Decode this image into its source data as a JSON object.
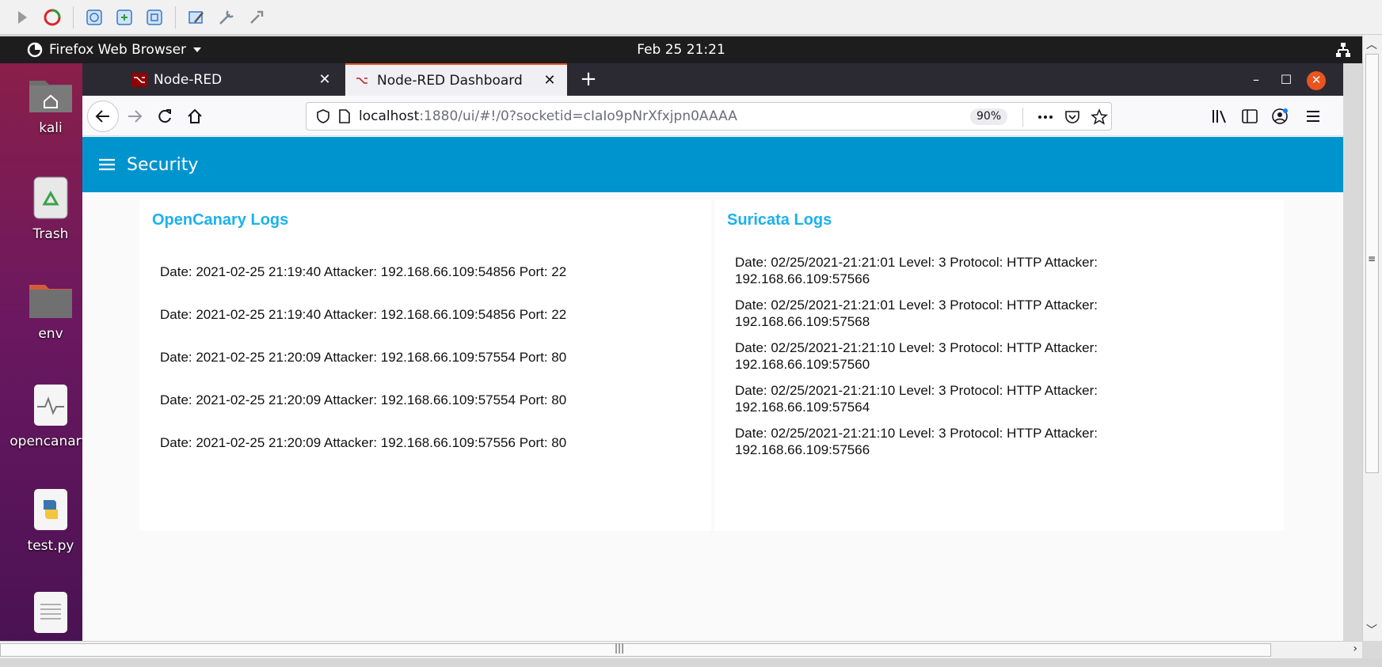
{
  "topbar": {
    "app_name": "Firefox Web Browser",
    "clock": "Feb 25  21:21"
  },
  "desktop": {
    "icons": [
      {
        "label": "kali"
      },
      {
        "label": "Trash"
      },
      {
        "label": "env"
      },
      {
        "label": "opencanary."
      },
      {
        "label": "test.py"
      }
    ]
  },
  "browser": {
    "tabs": [
      {
        "title": "Node-RED"
      },
      {
        "title": "Node-RED Dashboard"
      }
    ],
    "url_host": "localhost",
    "url_rest": ":1880/ui/#!/0?socketid=cIaIo9pNrXfxjpn0AAAA",
    "zoom": "90%"
  },
  "dashboard": {
    "title": "Security",
    "opencanary": {
      "title": "OpenCanary Logs",
      "entries": [
        "Date: 2021-02-25 21:19:40 Attacker: 192.168.66.109:54856 Port: 22",
        "Date: 2021-02-25 21:19:40 Attacker: 192.168.66.109:54856 Port: 22",
        "Date: 2021-02-25 21:20:09 Attacker: 192.168.66.109:57554 Port: 80",
        "Date: 2021-02-25 21:20:09 Attacker: 192.168.66.109:57554 Port: 80",
        "Date: 2021-02-25 21:20:09 Attacker: 192.168.66.109:57556 Port: 80"
      ]
    },
    "suricata": {
      "title": "Suricata Logs",
      "entries": [
        "Date: 02/25/2021-21:21:01 Level: 3 Protocol: HTTP Attacker: 192.168.66.109:57566",
        "Date: 02/25/2021-21:21:01 Level: 3 Protocol: HTTP Attacker: 192.168.66.109:57568",
        "Date: 02/25/2021-21:21:10 Level: 3 Protocol: HTTP Attacker: 192.168.66.109:57560",
        "Date: 02/25/2021-21:21:10 Level: 3 Protocol: HTTP Attacker: 192.168.66.109:57564",
        "Date: 02/25/2021-21:21:10 Level: 3 Protocol: HTTP Attacker: 192.168.66.109:57566"
      ]
    }
  },
  "colors": {
    "header": "#0094ce",
    "card_title": "#1bb2ec",
    "accent": "#e95420"
  }
}
